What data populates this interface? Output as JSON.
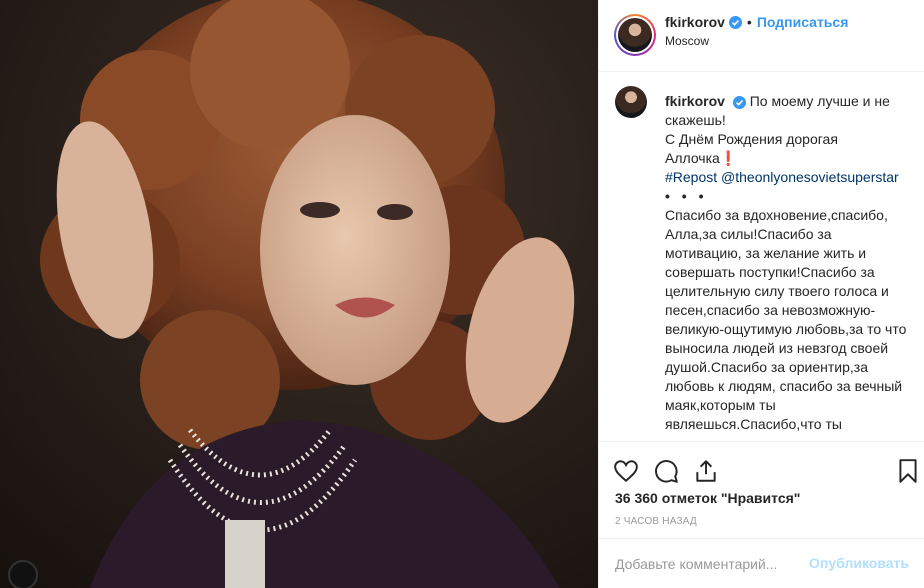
{
  "post": {
    "username": "fkirkorov",
    "follow_label": "Подписаться",
    "dot": "•",
    "location": "Moscow"
  },
  "caption": {
    "username": "fkirkorov",
    "line1": "По моему лучше и не скажешь!",
    "line2": "С Днём Рождения дорогая Аллочка❗",
    "hashtag": "#Repost",
    "mention": "@theonlyonesovietsuperstar",
    "dots": "• • •",
    "body": "Спасибо за вдохновение,спасибо, Алла,за силы!Спасибо за мотивацию, за желание жить и совершать поступки!Спасибо за целительную силу твоего голоса и песен,спасибо за невозможную-великую-ощутимую любовь,за то что выносила людей из невзгод своей душой.Спасибо за ориентир,за любовь к людям, спасибо за вечный маяк,которым ты являешься.Спасибо,что ты настоящая, единственная, истинная звезда, которая так нам всем нужна.Спасибо, что твой свет не"
  },
  "actions": {
    "like": "heart-icon",
    "comment": "comment-icon",
    "share": "share-icon",
    "save": "bookmark-icon"
  },
  "likes_text": "36 360 отметок \"Нравится\"",
  "time_text": "2 часов назад",
  "comment_box": {
    "placeholder": "Добавьте комментарий...",
    "publish_label": "Опубликовать"
  },
  "colors": {
    "accent": "#3897f0",
    "publish_disabled": "#b2dffc",
    "link": "#003569"
  }
}
